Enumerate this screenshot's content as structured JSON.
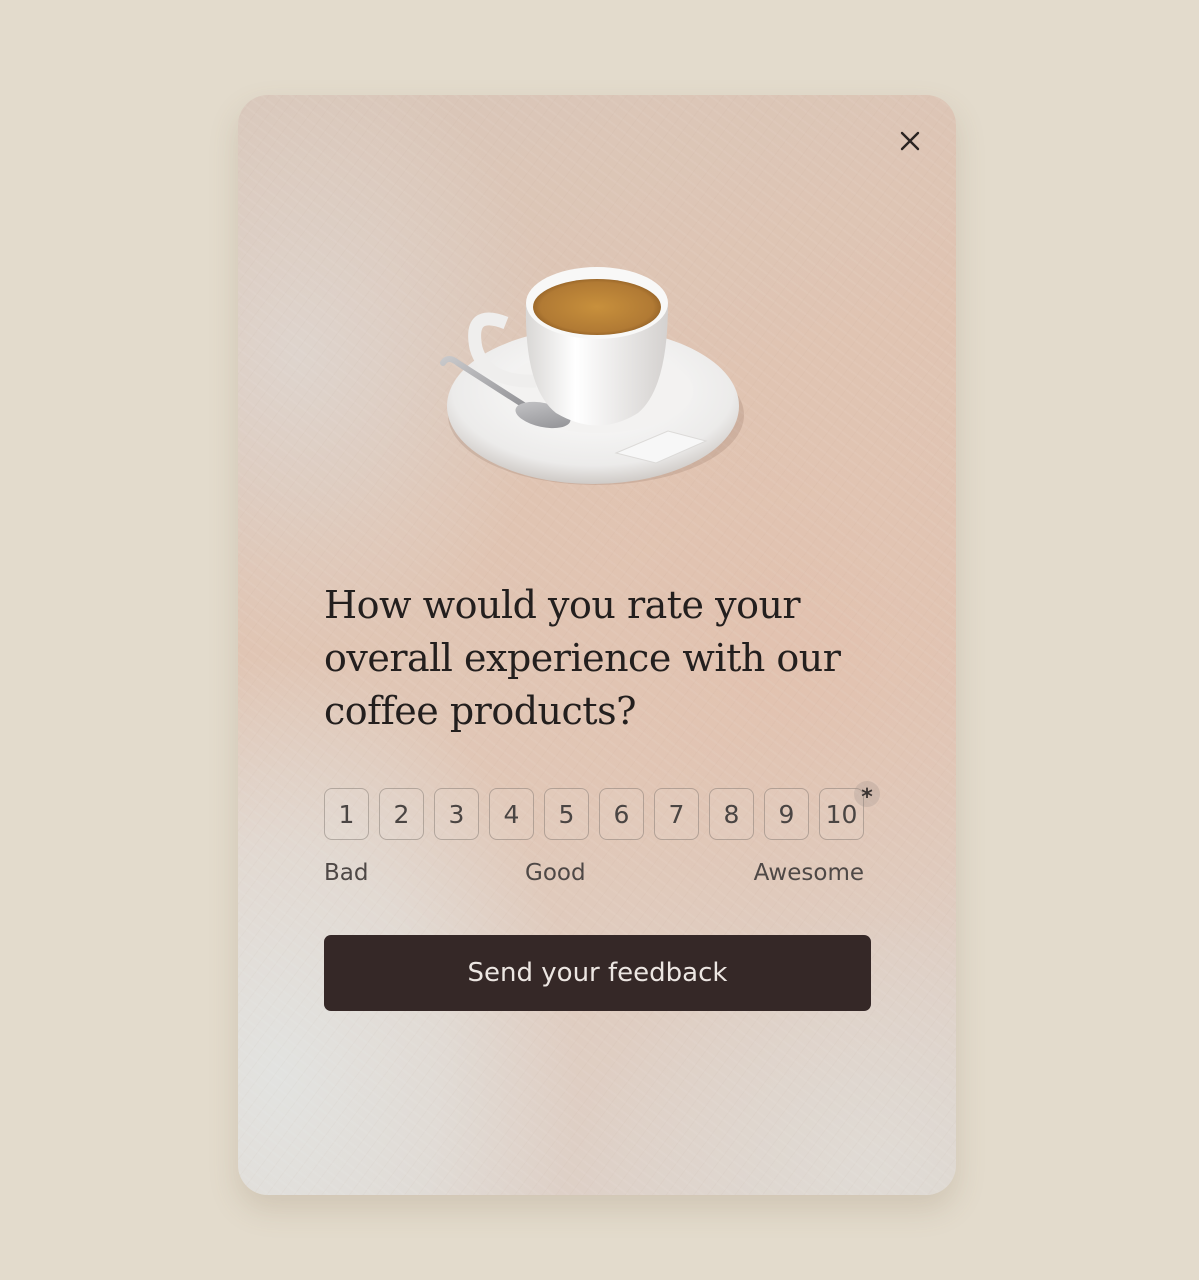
{
  "popup": {
    "close_icon": "close-icon",
    "image": "coffee-cup-on-saucer",
    "question": "How would you rate your overall experience with our coffee products?",
    "rating": {
      "options": [
        "1",
        "2",
        "3",
        "4",
        "5",
        "6",
        "7",
        "8",
        "9",
        "10"
      ],
      "required_marker": "*",
      "labels": {
        "low": "Bad",
        "mid": "Good",
        "high": "Awesome"
      }
    },
    "submit_label": "Send your feedback",
    "colors": {
      "page_background": "#e3dbcc",
      "button_background": "#352827",
      "button_text": "#ece6e2",
      "text_primary": "#231f1e"
    }
  }
}
